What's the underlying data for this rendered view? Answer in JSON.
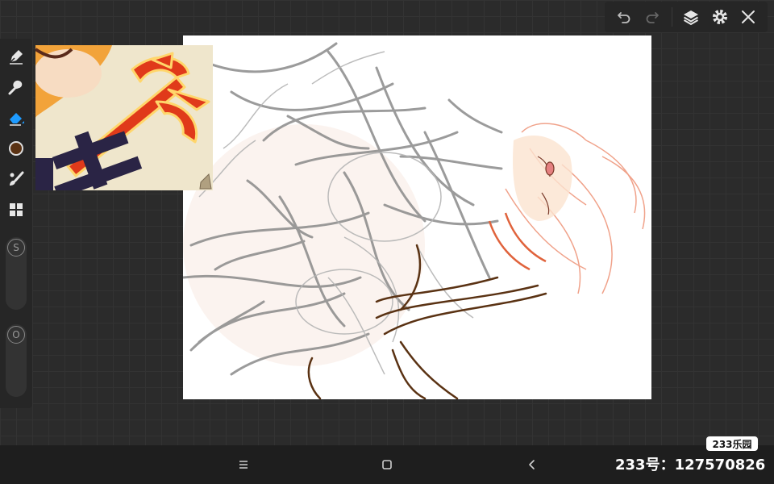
{
  "toolbar": {
    "icons": [
      "undo-icon",
      "redo-icon",
      "layers-icon",
      "settings-icon",
      "close-icon"
    ]
  },
  "tools": {
    "icons": [
      "pen-icon",
      "smudge-icon",
      "eraser-icon",
      "color-swatch",
      "brush-icon",
      "gallery-icon"
    ],
    "current_color": "#5a3213",
    "accent_color": "#1e9bff",
    "size_slider_label": "S",
    "opacity_slider_label": "O"
  },
  "navigation": {
    "icons": [
      "menu-icon",
      "home-icon",
      "back-icon"
    ]
  },
  "watermark": {
    "logo": "233乐园",
    "id_text": "233号：127570826"
  }
}
